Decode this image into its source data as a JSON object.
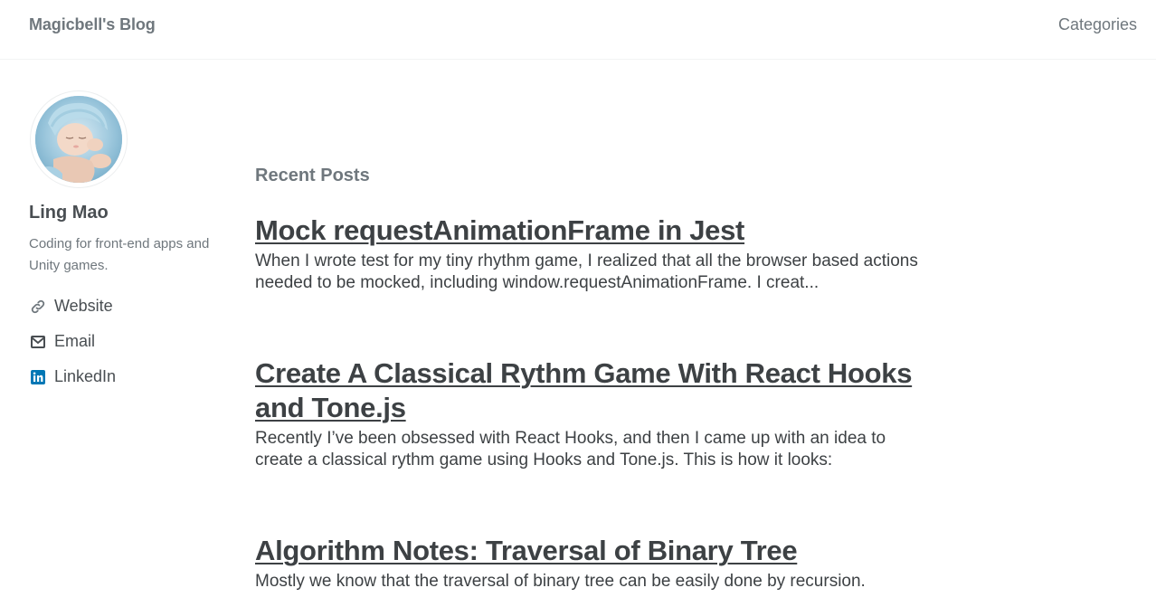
{
  "header": {
    "site_title": "Magicbell's Blog",
    "nav": [
      {
        "label": "Categories"
      }
    ]
  },
  "author": {
    "avatar_icon": "baby-photo-avatar",
    "name": "Ling Mao",
    "bio": "Coding for front-end apps and Unity games.",
    "links": [
      {
        "label": "Website",
        "icon": "link-icon"
      },
      {
        "label": "Email",
        "icon": "envelope-icon"
      },
      {
        "label": "LinkedIn",
        "icon": "linkedin-icon"
      }
    ]
  },
  "main": {
    "section_title": "Recent Posts",
    "posts": [
      {
        "title": "Mock requestAnimationFrame in Jest",
        "excerpt": "When I wrote test for my tiny rhythm game, I realized that all the browser based actions needed to be mocked, including window.requestAnimationFrame. I creat..."
      },
      {
        "title": "Create A Classical Rythm Game With React Hooks and Tone.js",
        "excerpt": "Recently I’ve been obsessed with React Hooks, and then I came up with an idea to create a classical rythm game using Hooks and Tone.js. This is how it looks:"
      },
      {
        "title": "Algorithm Notes: Traversal of Binary Tree",
        "excerpt": "Mostly we know that the traversal of binary tree can be easily done by recursion."
      }
    ]
  },
  "colors": {
    "linkedin": "#0077b5",
    "muted_text": "#6f777d",
    "body_text": "#3d4144"
  }
}
